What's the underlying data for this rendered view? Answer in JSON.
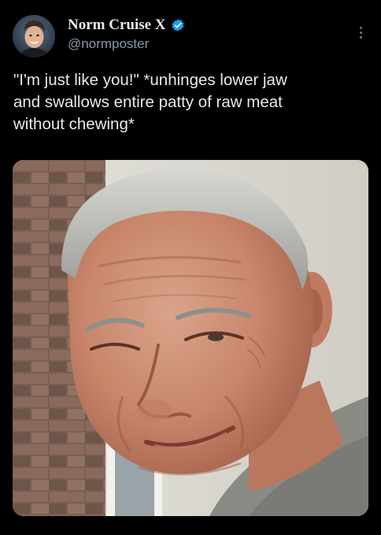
{
  "author": {
    "display_name": "Norm Cruise X",
    "handle": "@normposter",
    "verified": true,
    "avatar_icon": "user-avatar"
  },
  "tweet": {
    "lines": [
      "\"I'm just like you!\" *unhinges lower jaw",
      "and swallows entire patty of raw meat",
      "without chewing*"
    ]
  },
  "media": {
    "kind": "photo",
    "subject": "smiling older man close-up"
  },
  "colors": {
    "background": "#000000",
    "text": "#e7e9ea",
    "secondary_text": "#8b98a5",
    "verified_badge": "#1d9bf0"
  }
}
